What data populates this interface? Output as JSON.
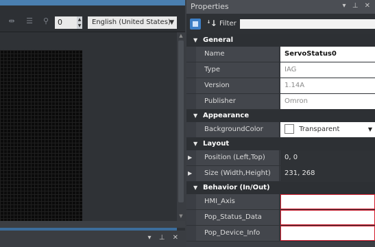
{
  "left_panel": {
    "toolbar": {
      "zoom_value": "0",
      "language": "English (United States)"
    },
    "bottom_controls": "▾ ⊥ ✕"
  },
  "properties": {
    "title": "Properties",
    "title_controls": "▾ ⊥ ✕",
    "filter_label": "Filter",
    "categories": [
      {
        "name": "General"
      },
      {
        "name": "Appearance"
      },
      {
        "name": "Layout"
      },
      {
        "name": "Behavior (In/Out)"
      }
    ],
    "general": {
      "name_label": "Name",
      "name_value": "ServoStatus0",
      "type_label": "Type",
      "type_value": "IAG",
      "version_label": "Version",
      "version_value": "1.14A",
      "publisher_label": "Publisher",
      "publisher_value": "Omron"
    },
    "appearance": {
      "bg_label": "BackgroundColor",
      "bg_value": "Transparent"
    },
    "layout": {
      "position_label": "Position (Left,Top)",
      "position_value": "0, 0",
      "size_label": "Size (Width,Height)",
      "size_value": "231, 268"
    },
    "behavior": {
      "hmi_label": "HMI_Axis",
      "hmi_value": "",
      "pop_status_label": "Pop_Status_Data",
      "pop_status_value": "",
      "pop_device_label": "Pop_Device_Info",
      "pop_device_value": ""
    }
  },
  "colors": {
    "error_border": "#d21b2c",
    "accent": "#3d7fc6"
  }
}
